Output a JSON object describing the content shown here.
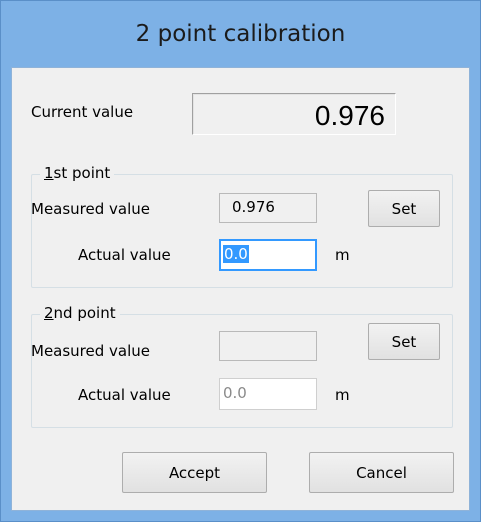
{
  "window": {
    "title": "2 point calibration"
  },
  "current": {
    "label": "Current value",
    "value": "0.976"
  },
  "point1": {
    "group_title_mnemonic": "1",
    "group_title_rest": "st point",
    "measured_label": "Measured value",
    "measured_value": "0.976",
    "set_label": "Set",
    "actual_label": "Actual value",
    "actual_value": "0.0",
    "unit": "m"
  },
  "point2": {
    "group_title_mnemonic": "2",
    "group_title_rest": "nd point",
    "measured_label": "Measured value",
    "measured_value": "",
    "set_label": "Set",
    "actual_label": "Actual value",
    "actual_value": "0.0",
    "unit": "m"
  },
  "footer": {
    "accept_label": "Accept",
    "cancel_label": "Cancel"
  },
  "colors": {
    "title_bar": "#7db1e6",
    "selection": "#3399ff",
    "client_background": "#f0f0f0"
  }
}
